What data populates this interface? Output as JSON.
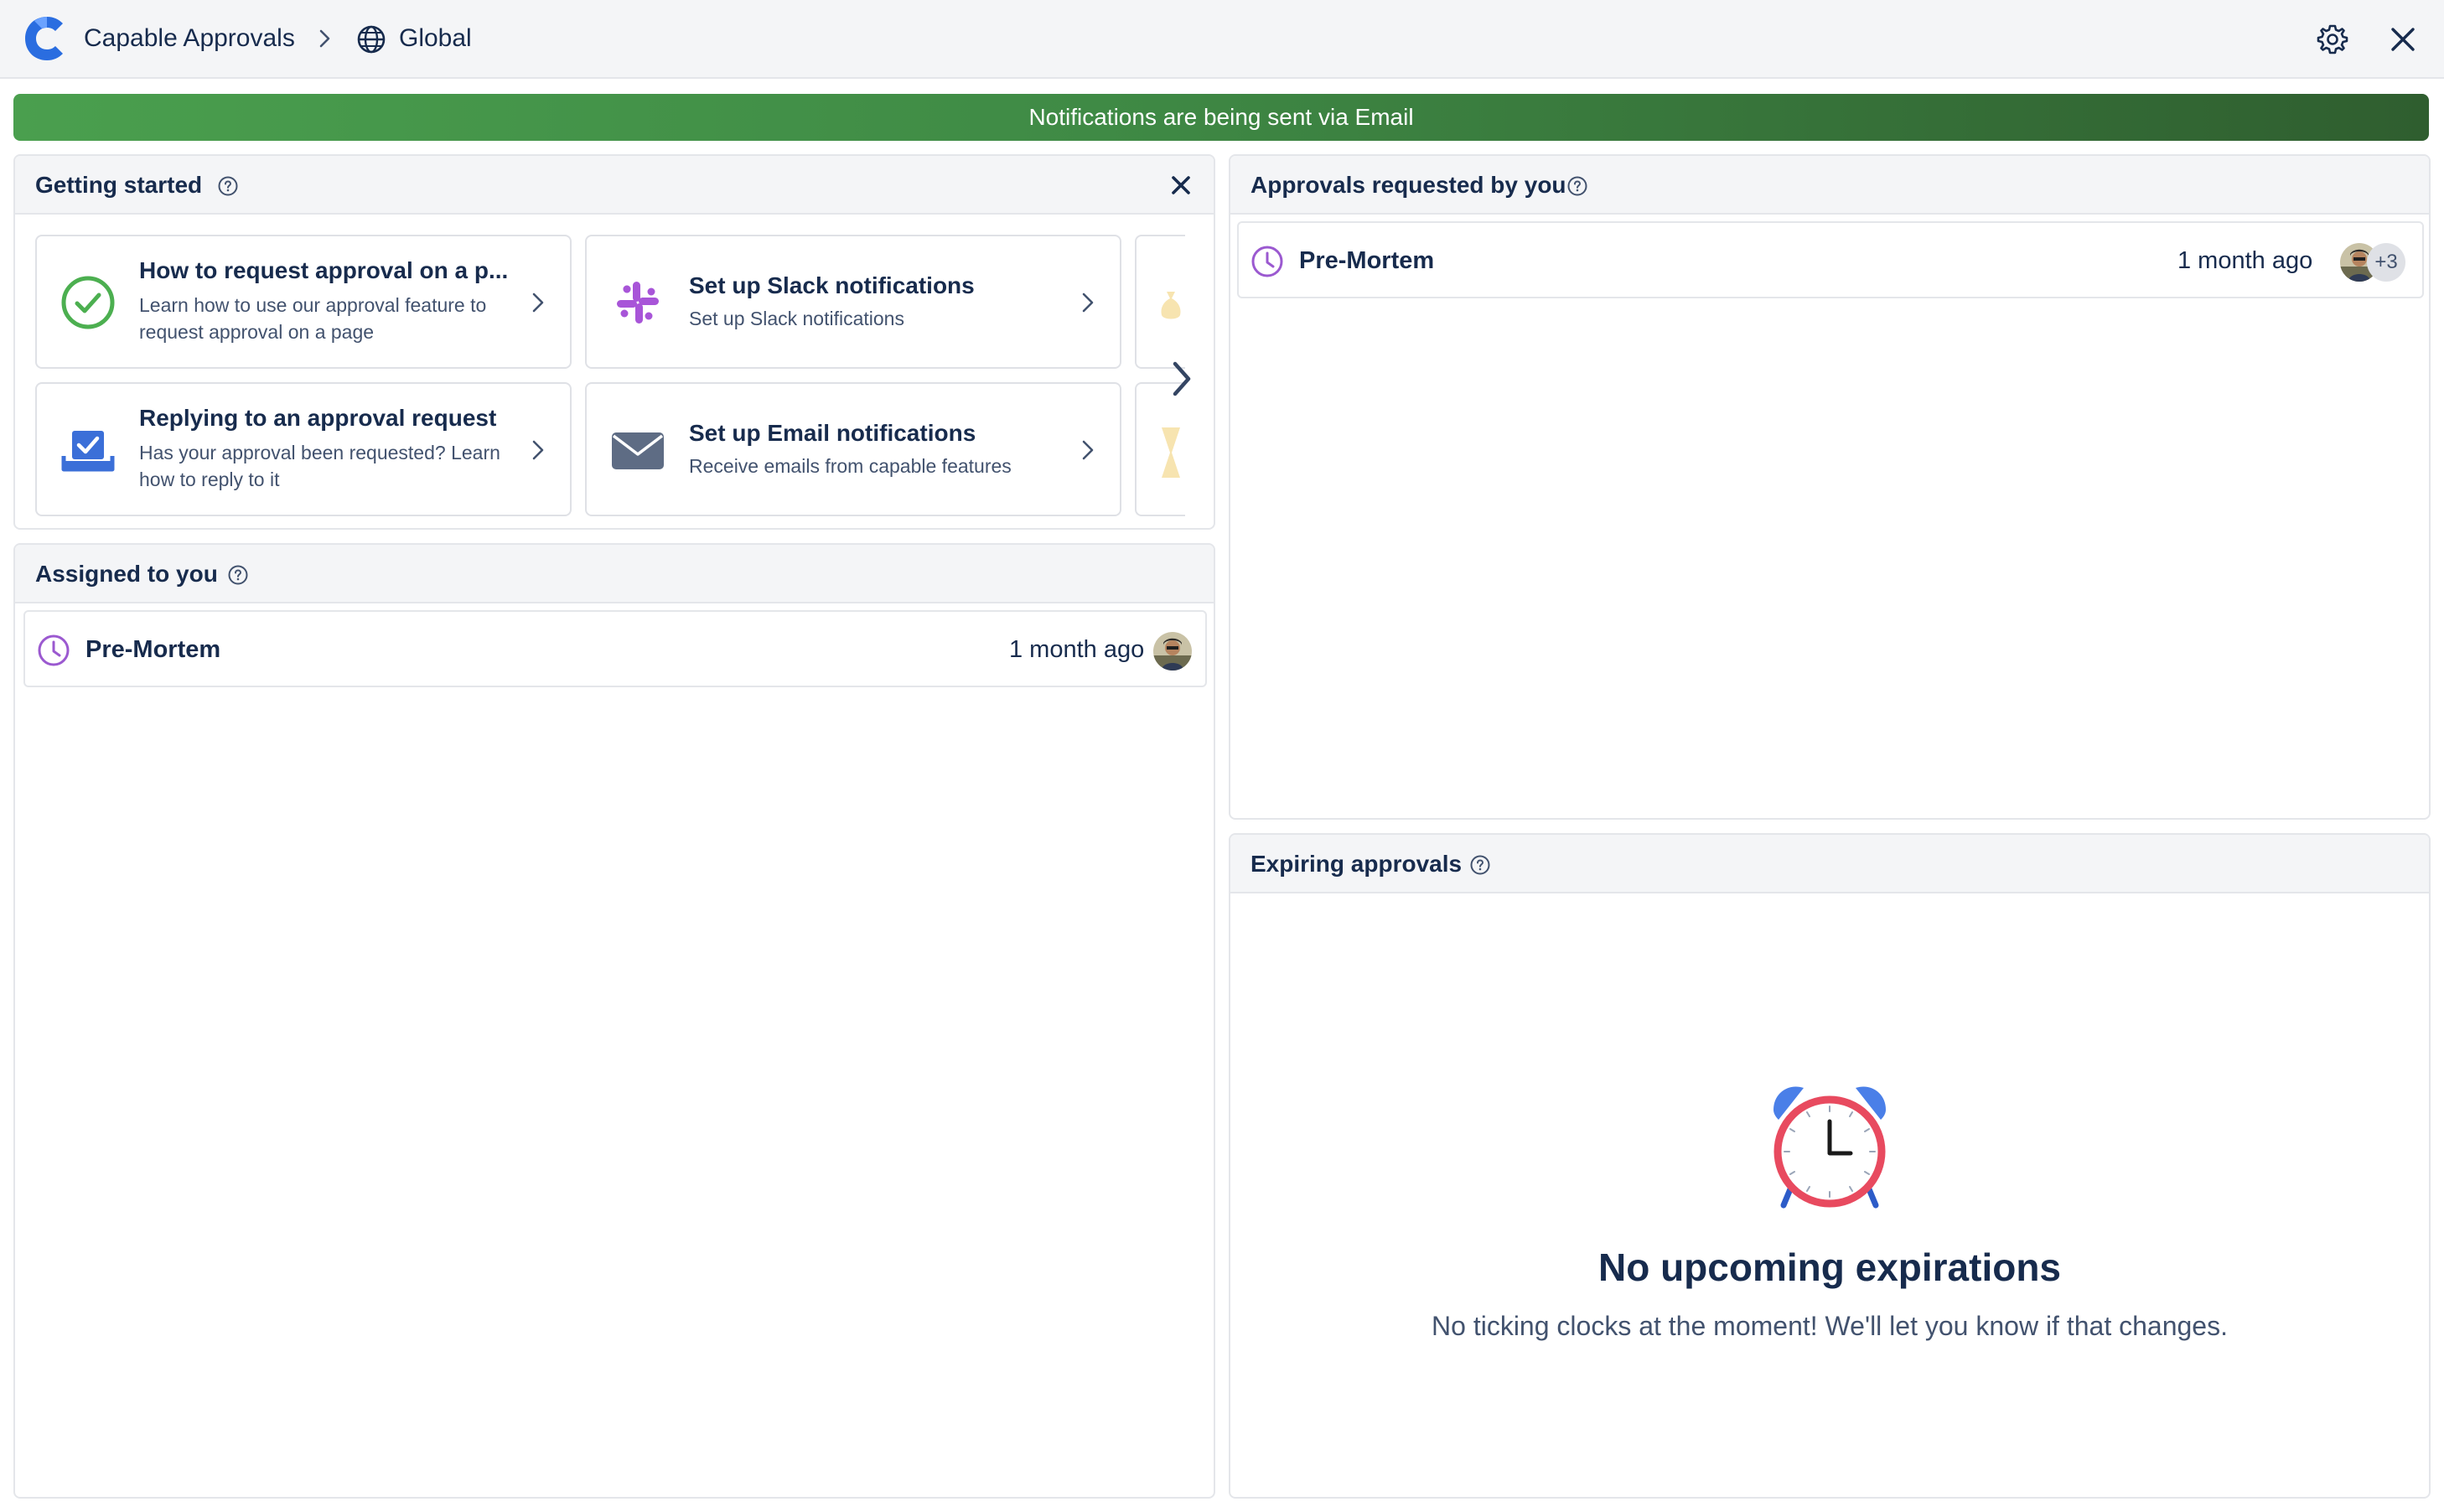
{
  "header": {
    "app_name": "Capable Approvals",
    "scope": "Global"
  },
  "banner": {
    "text": "Notifications are being sent via Email"
  },
  "getting_started": {
    "title": "Getting started",
    "cards": [
      {
        "title": "How to request approval on a p...",
        "desc": "Learn how to use our approval feature to request approval on a page"
      },
      {
        "title": "Set up Slack notifications",
        "desc": "Set up Slack notifications"
      },
      {
        "title": "Replying to an approval request",
        "desc": "Has your approval been requested? Learn how to reply to it"
      },
      {
        "title": "Set up Email notifications",
        "desc": "Receive emails from capable features"
      }
    ]
  },
  "assigned": {
    "title": "Assigned to you",
    "items": [
      {
        "title": "Pre-Mortem",
        "time": "1 month ago"
      }
    ]
  },
  "requested": {
    "title": "Approvals requested by you",
    "items": [
      {
        "title": "Pre-Mortem",
        "time": "1 month ago",
        "more": "+3"
      }
    ]
  },
  "expiring": {
    "title": "Expiring approvals",
    "empty_title": "No upcoming expirations",
    "empty_desc": "No ticking clocks at the moment! We'll let you know if that changes."
  },
  "colors": {
    "brand": "#1f6feb",
    "banner_start": "#4a9f4e",
    "banner_end": "#2f5e2f",
    "clock_purple": "#9b59d0",
    "success_green": "#4caf50"
  }
}
